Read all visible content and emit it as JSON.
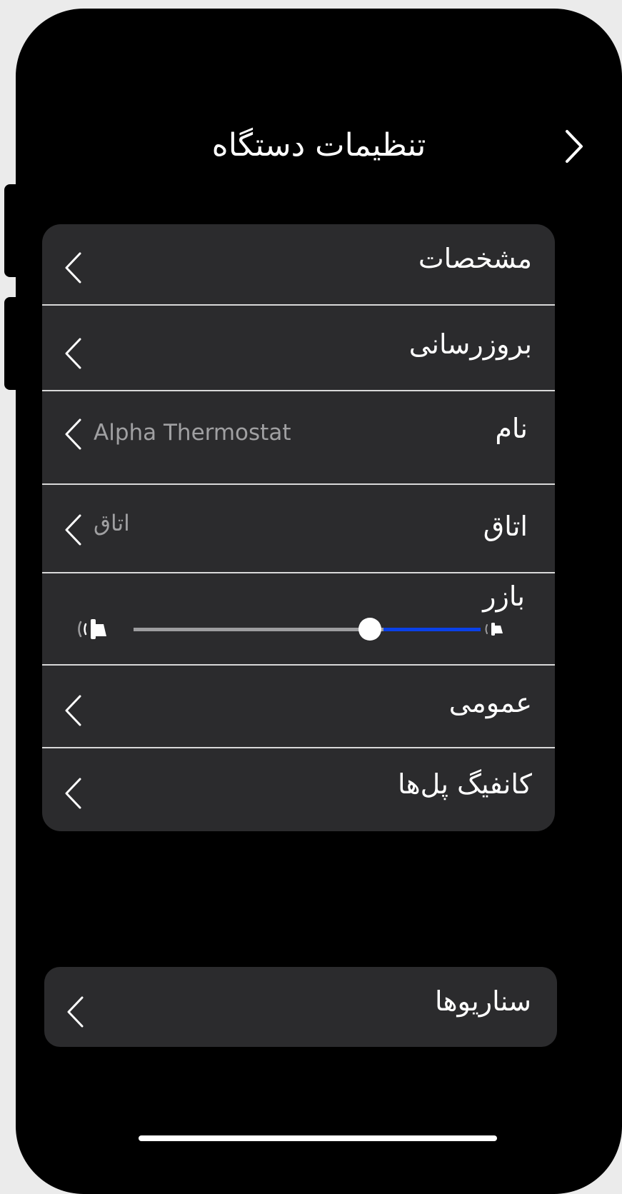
{
  "header": {
    "title": "تنظیمات دستگاه",
    "back_icon": "chevron-right-icon"
  },
  "settings": {
    "specs": {
      "label": "مشخصات"
    },
    "update": {
      "label": "بروزرسانی"
    },
    "name": {
      "label": "نام",
      "value": "Alpha Thermostat"
    },
    "room": {
      "label": "اتاق",
      "value": "اتاق"
    },
    "buzzer": {
      "label": "بازر",
      "volume_fraction": 0.29,
      "min_icon": "speaker-low-icon",
      "max_icon": "speaker-high-icon"
    },
    "general": {
      "label": "عمومی"
    },
    "bridge_config": {
      "label": "کانفیگ پل‌ها"
    }
  },
  "scenarios": {
    "label": "سناریوها"
  },
  "colors": {
    "background": "#000000",
    "card": "#2b2b2d",
    "separator": "#d9d9d9",
    "accent": "#0a41e8",
    "secondary_text": "#a0a0a2"
  }
}
